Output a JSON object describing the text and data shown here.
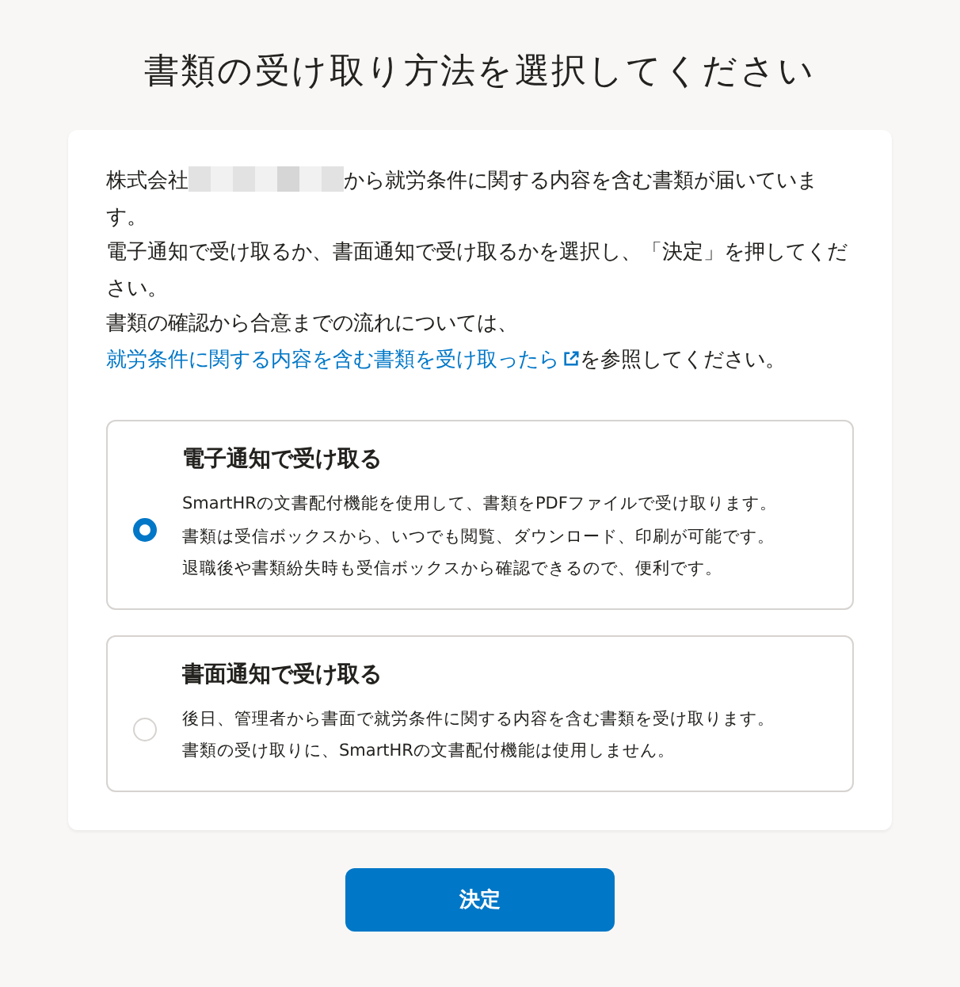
{
  "title": "書類の受け取り方法を選択してください",
  "intro": {
    "prefix": "株式会社",
    "suffix": "から就労条件に関する内容を含む書類が届いています。",
    "line2": "電子通知で受け取るか、書面通知で受け取るかを選択し、「決定」を押してください。",
    "line3_before": "書類の確認から合意までの流れについては、",
    "link": "就労条件に関する内容を含む書類を受け取ったら",
    "line3_after": "を参照してください。"
  },
  "options": [
    {
      "label": "電子通知で受け取る",
      "selected": true,
      "description": [
        "SmartHRの文書配付機能を使用して、書類をPDFファイルで受け取ります。",
        "書類は受信ボックスから、いつでも閲覧、ダウンロード、印刷が可能です。",
        "退職後や書類紛失時も受信ボックスから確認できるので、便利です。"
      ]
    },
    {
      "label": "書面通知で受け取る",
      "selected": false,
      "description": [
        "後日、管理者から書面で就労条件に関する内容を含む書類を受け取ります。",
        "書類の受け取りに、SmartHRの文書配付機能は使用しません。"
      ]
    }
  ],
  "submit": "決定"
}
